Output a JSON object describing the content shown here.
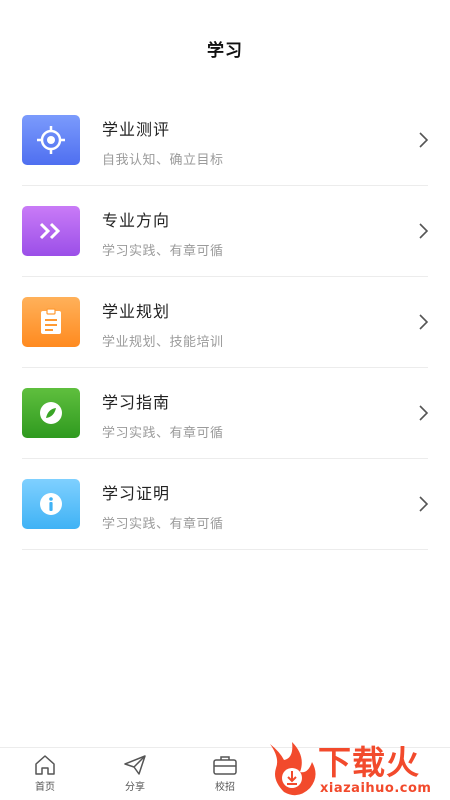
{
  "header": {
    "title": "学习"
  },
  "menu": {
    "items": [
      {
        "title": "学业测评",
        "subtitle": "自我认知、确立目标",
        "icon": "target-icon",
        "color_top": "#7b9bfc",
        "color_bottom": "#4f6ff0"
      },
      {
        "title": "专业方向",
        "subtitle": "学习实践、有章可循",
        "icon": "double-chevron-icon",
        "color_top": "#c97bf7",
        "color_bottom": "#9b4fe8"
      },
      {
        "title": "学业规划",
        "subtitle": "学业规划、技能培训",
        "icon": "clipboard-icon",
        "color_top": "#ffb15a",
        "color_bottom": "#ff8a1f"
      },
      {
        "title": "学习指南",
        "subtitle": "学习实践、有章可循",
        "icon": "compass-icon",
        "color_top": "#5fbf3e",
        "color_bottom": "#2f9a1f"
      },
      {
        "title": "学习证明",
        "subtitle": "学习实践、有章可循",
        "icon": "info-icon",
        "color_top": "#7fd0ff",
        "color_bottom": "#3fb2f5"
      }
    ]
  },
  "tabbar": {
    "tabs": [
      {
        "label": "首页",
        "icon": "home-icon"
      },
      {
        "label": "分享",
        "icon": "paper-plane-icon"
      },
      {
        "label": "校招",
        "icon": "briefcase-icon"
      }
    ]
  },
  "watermark": {
    "brand": "下载火",
    "domain": "xiazaihuo.com"
  }
}
